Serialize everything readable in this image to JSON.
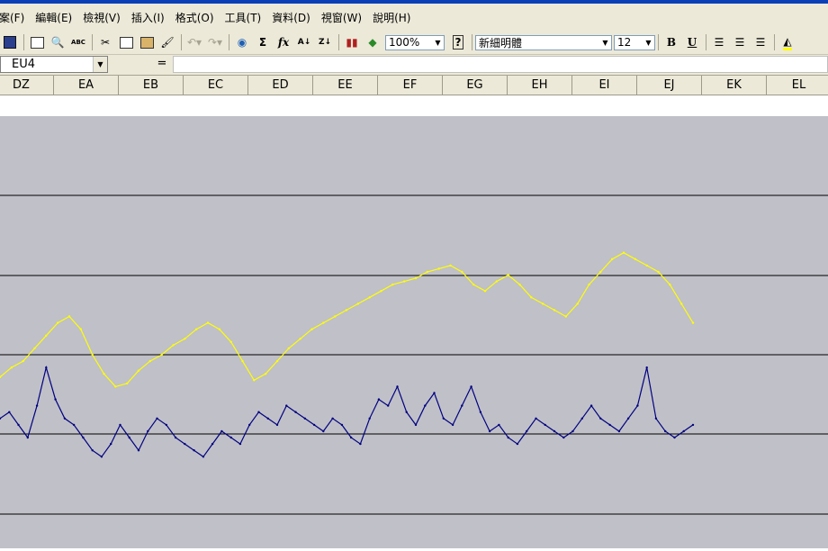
{
  "menubar": {
    "items": [
      {
        "id": "file",
        "label": "案(F)"
      },
      {
        "id": "edit",
        "label": "編輯(E)"
      },
      {
        "id": "view",
        "label": "檢視(V)"
      },
      {
        "id": "insert",
        "label": "插入(I)"
      },
      {
        "id": "format",
        "label": "格式(O)"
      },
      {
        "id": "tools",
        "label": "工具(T)"
      },
      {
        "id": "data",
        "label": "資料(D)"
      },
      {
        "id": "window",
        "label": "視窗(W)"
      },
      {
        "id": "help",
        "label": "說明(H)"
      }
    ]
  },
  "toolbar": {
    "zoom": "100%",
    "font_name": "新細明體",
    "font_size": "12",
    "bold_label": "B",
    "underline_label": "U",
    "sum_label": "Σ",
    "fx_label": "fx",
    "spell_label": "ABC"
  },
  "formula_bar": {
    "name_box": "EU4",
    "equals": "=",
    "value": ""
  },
  "columns": [
    "DZ",
    "EA",
    "EB",
    "EC",
    "ED",
    "EE",
    "EF",
    "EG",
    "EH",
    "EI",
    "EJ",
    "EK",
    "EL"
  ],
  "chart_data": {
    "type": "line",
    "title": "",
    "xlabel": "",
    "ylabel": "",
    "plot_background": "#c0c0c8",
    "grid": true,
    "series": [
      {
        "color": "#ffff00",
        "values": [
          43,
          46,
          48,
          52,
          56,
          60,
          62,
          58,
          50,
          44,
          40,
          41,
          45,
          48,
          50,
          53,
          55,
          58,
          60,
          58,
          54,
          48,
          42,
          44,
          48,
          52,
          55,
          58,
          60,
          62,
          64,
          66,
          68,
          70,
          72,
          73,
          74,
          76,
          77,
          78,
          76,
          72,
          70,
          73,
          75,
          72,
          68,
          66,
          64,
          62,
          66,
          72,
          76,
          80,
          82,
          80,
          78,
          76,
          72,
          66,
          60
        ]
      },
      {
        "color": "#000080",
        "values": [
          30,
          32,
          28,
          24,
          34,
          46,
          36,
          30,
          28,
          24,
          20,
          18,
          22,
          28,
          24,
          20,
          26,
          30,
          28,
          24,
          22,
          20,
          18,
          22,
          26,
          24,
          22,
          28,
          32,
          30,
          28,
          34,
          32,
          30,
          28,
          26,
          30,
          28,
          24,
          22,
          30,
          36,
          34,
          40,
          32,
          28,
          34,
          38,
          30,
          28,
          34,
          40,
          32,
          26,
          28,
          24,
          22,
          26,
          30,
          28,
          26,
          24,
          26,
          30,
          34,
          30,
          28,
          26,
          30,
          34,
          46,
          30,
          26,
          24,
          26,
          28
        ]
      }
    ]
  }
}
